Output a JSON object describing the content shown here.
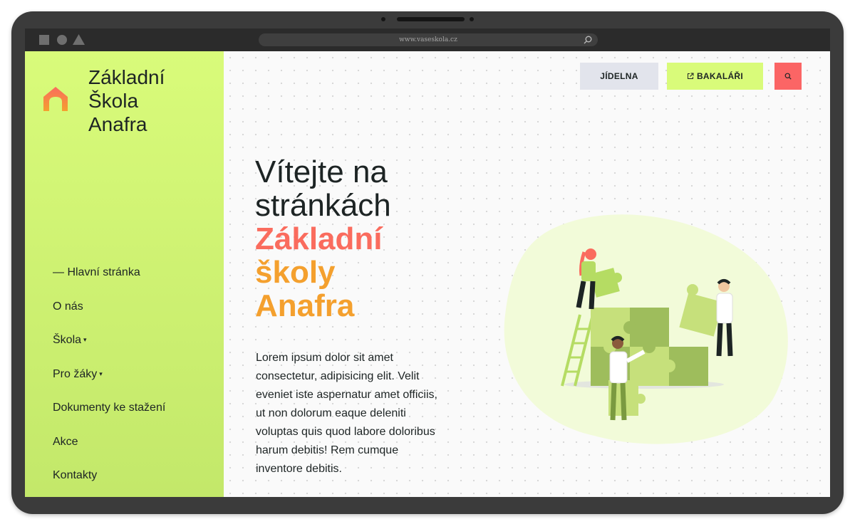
{
  "browser": {
    "url": "www.vaseskola.cz"
  },
  "sidebar": {
    "brand": [
      "Základní",
      "Škola",
      "Anafra"
    ],
    "nav": [
      {
        "label": "— Hlavní stránka",
        "caret": ""
      },
      {
        "label": "O nás",
        "caret": ""
      },
      {
        "label": "Škola",
        "caret": "▾"
      },
      {
        "label": "Pro žáky",
        "caret": "▾"
      },
      {
        "label": "Dokumenty ke stažení",
        "caret": ""
      },
      {
        "label": "Akce",
        "caret": ""
      },
      {
        "label": "Kontakty",
        "caret": ""
      }
    ]
  },
  "header": {
    "jidelna_label": "JÍDELNA",
    "bakalari_label": "BAKALÁŘI",
    "search_icon": "search-icon"
  },
  "hero": {
    "line1": "Vítejte na",
    "line2": "stránkách",
    "line3": "Základní",
    "line4": "školy",
    "line5": "Anafra",
    "paragraph": "Lorem ipsum dolor sit amet consectetur, adipisicing elit. Velit eveniet iste aspernatur amet officiis, ut non dolorum eaque deleniti voluptas quis quod labore doloribus harum debitis! Rem cumque inventore debitis."
  },
  "colors": {
    "accent_green": "#d9fb7a",
    "accent_red": "#fa6c5e",
    "accent_orange": "#f4a02e",
    "text_dark": "#1d2424"
  }
}
